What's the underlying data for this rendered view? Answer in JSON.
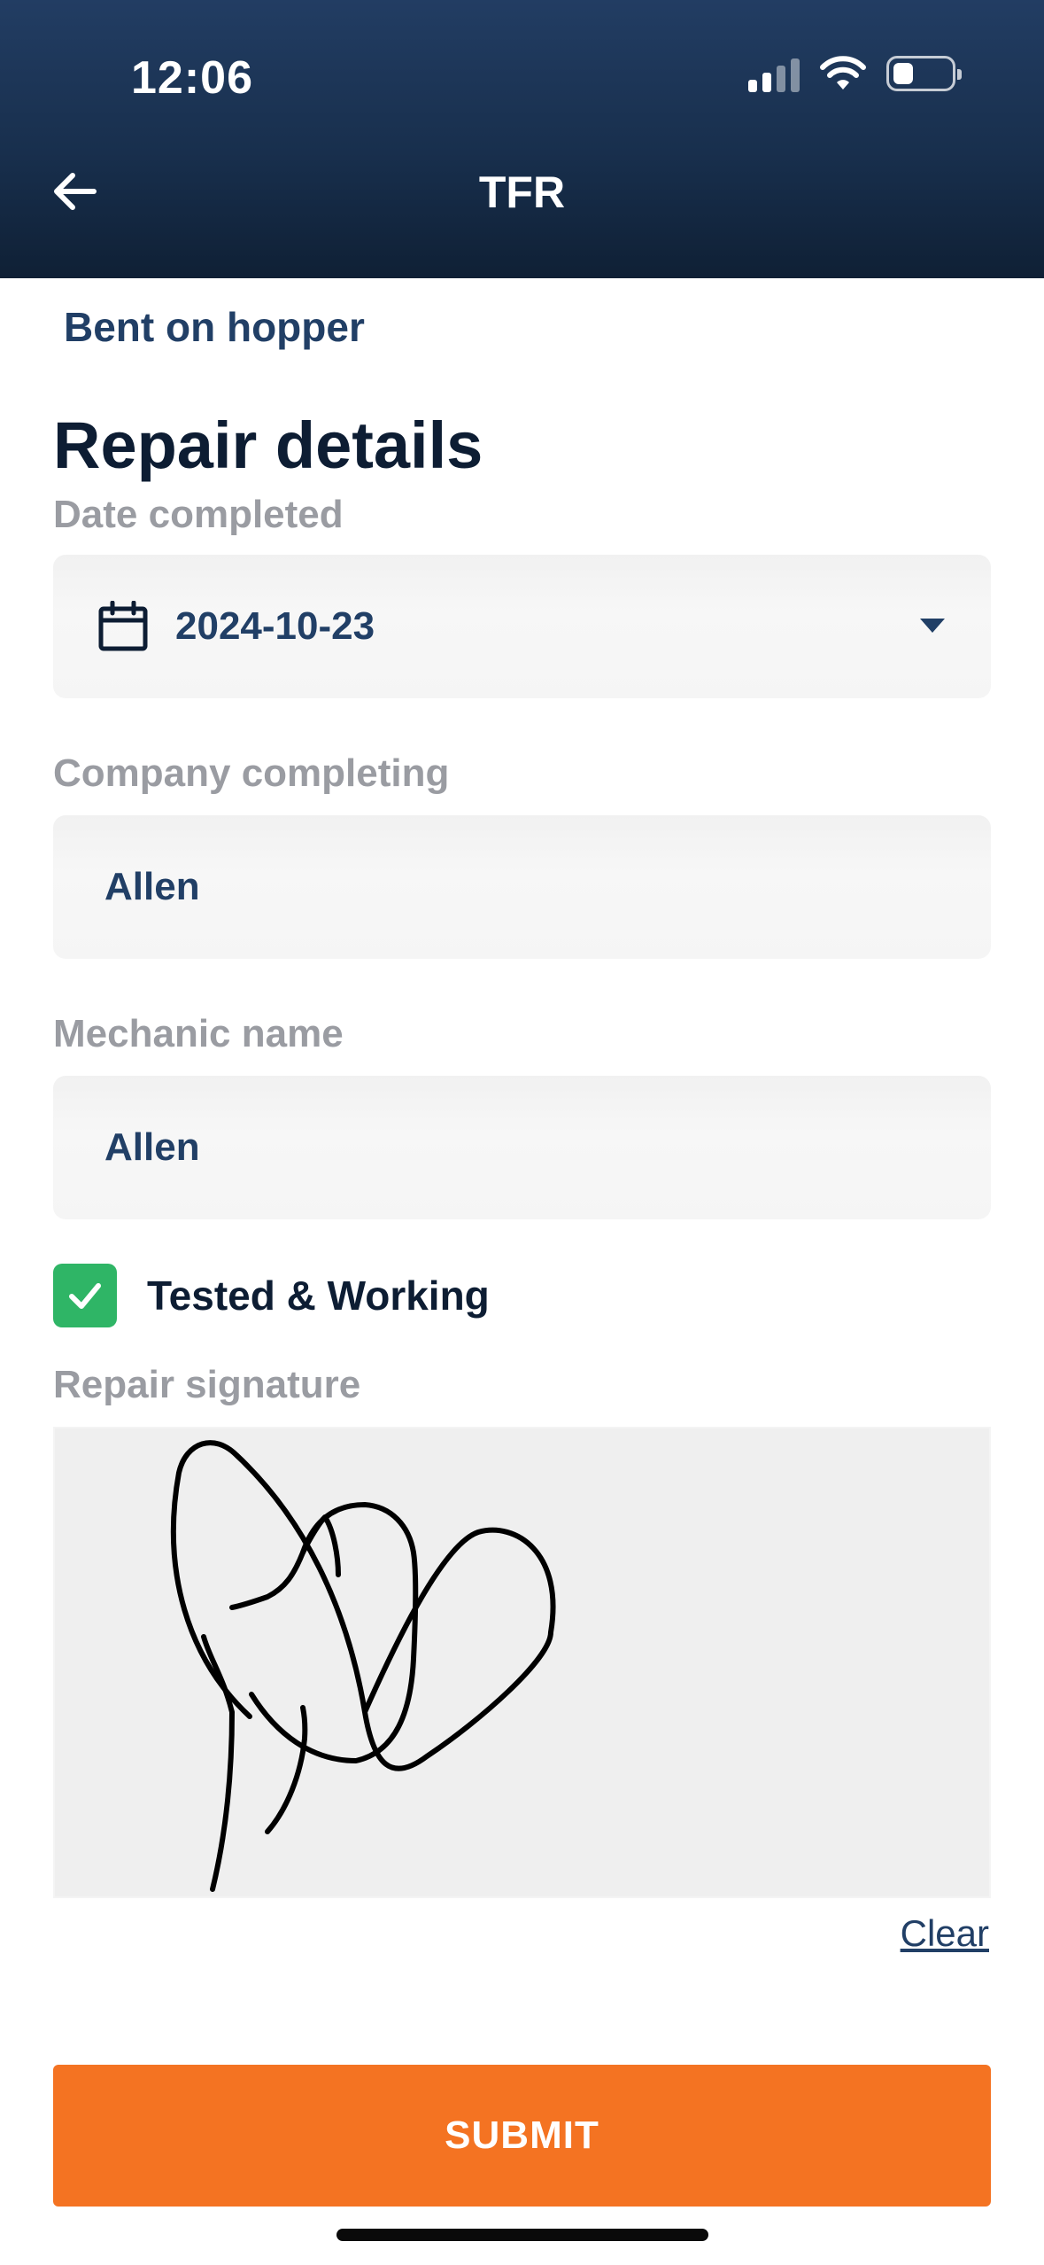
{
  "status_bar": {
    "time": "12:06"
  },
  "header": {
    "title": "TFR"
  },
  "issue": {
    "text": "Bent on hopper"
  },
  "section": {
    "title": "Repair details"
  },
  "fields": {
    "date": {
      "label": "Date completed",
      "value": "2024-10-23"
    },
    "company": {
      "label": "Company completing",
      "value": "Allen"
    },
    "mechanic": {
      "label": "Mechanic name",
      "value": "Allen"
    }
  },
  "tested": {
    "label": "Tested & Working",
    "checked": true
  },
  "signature": {
    "label": "Repair signature",
    "clear_label": "Clear"
  },
  "submit": {
    "label": "SUBMIT"
  },
  "colors": {
    "header": "#1b3352",
    "accent": "#f47322",
    "check": "#2fb566",
    "text_primary": "#213f66"
  }
}
